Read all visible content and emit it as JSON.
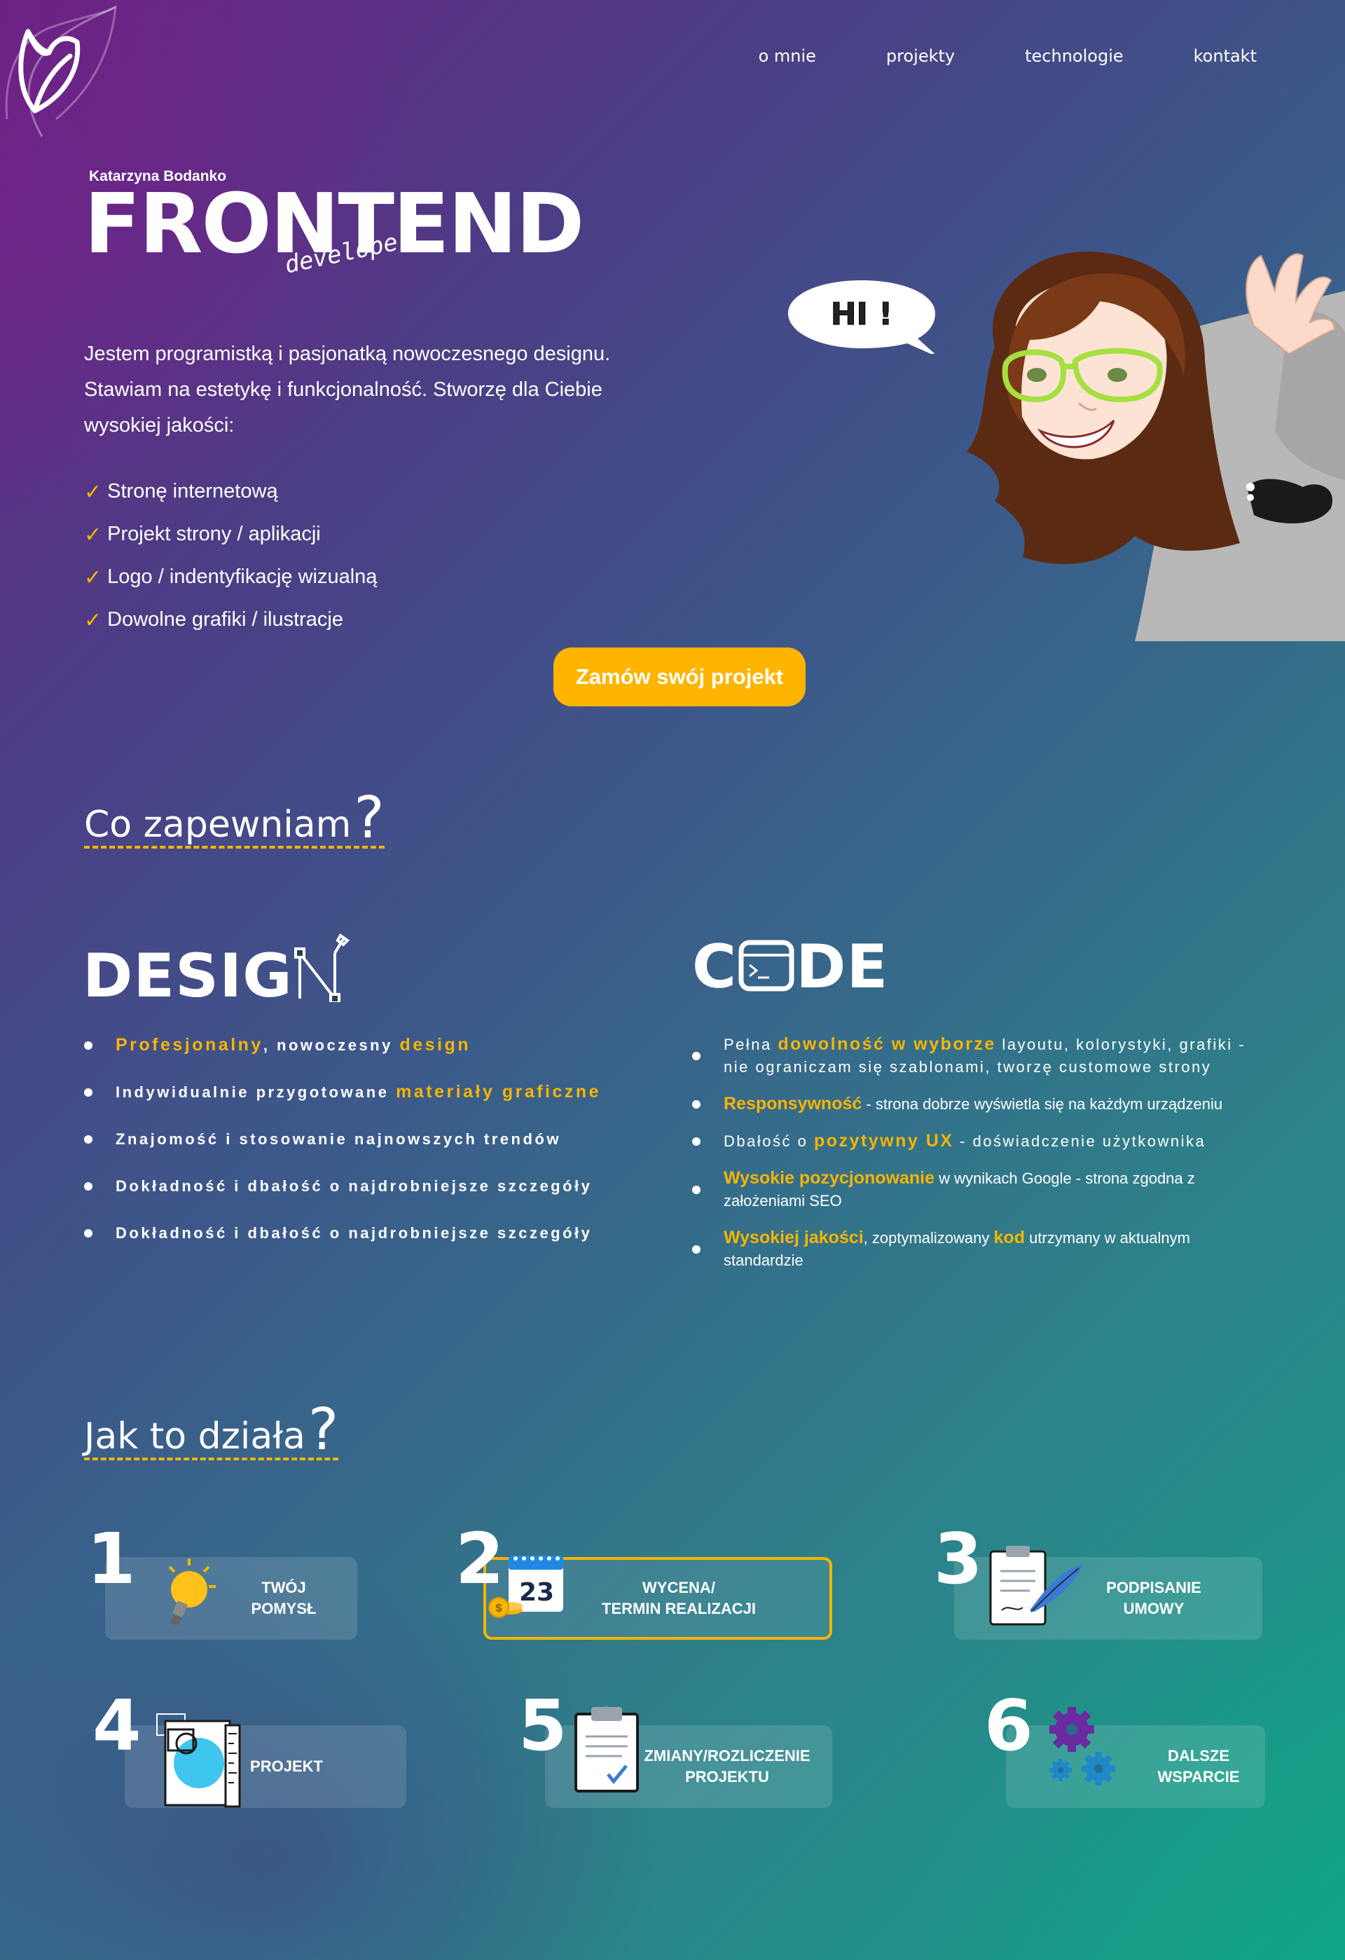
{
  "nav": {
    "items": [
      "o mnie",
      "projekty",
      "technologie",
      "kontakt"
    ]
  },
  "hero": {
    "name": "Katarzyna Bodanko",
    "title": "FRONTEND",
    "subtitle": "developer",
    "intro": "Jestem programistką i pasjonatką nowoczesnego designu. Stawiam na estetykę i funkcjonalność. Stworzę dla Ciebie wysokiej jakości:",
    "checklist": [
      "Stronę internetową",
      "Projekt strony / aplikacji",
      "Logo / indentyfikację wizualną",
      "Dowolne grafiki / ilustracje"
    ],
    "cta": "Zamów swój projekt",
    "bubble": "HI !"
  },
  "offer": {
    "heading": "Co zapewniam",
    "qmark": "?",
    "design_word": "DESIG",
    "design_icon": "pen-tool-n-icon",
    "code_word_left": "C",
    "code_word_right": "DE",
    "code_icon": "terminal-window-icon",
    "design_items": [
      {
        "parts": [
          {
            "t": "Profesjonalny",
            "hl": true
          },
          {
            "t": ", nowoczesny ",
            "hl": false
          },
          {
            "t": "design",
            "hl": true
          }
        ]
      },
      {
        "parts": [
          {
            "t": "Indywidualnie przygotowane ",
            "hl": false
          },
          {
            "t": "materiały graficzne",
            "hl": true
          }
        ]
      },
      {
        "parts": [
          {
            "t": "Znajomość i stosowanie najnowszych trendów",
            "hl": false
          }
        ]
      },
      {
        "parts": [
          {
            "t": "Dokładność i dbałość o najdrobniejsze szczegóły",
            "hl": false
          }
        ]
      },
      {
        "parts": [
          {
            "t": "Dokładność i dbałość o najdrobniejsze szczegóły",
            "hl": false
          }
        ]
      }
    ],
    "code_items": [
      {
        "spaced": true,
        "parts": [
          {
            "t": "Pełna ",
            "hl": false
          },
          {
            "t": "dowolność w wyborze",
            "hl": true
          },
          {
            "t": " layoutu, kolorystyki, grafiki - nie ograniczam się szablonami, tworzę customowe strony",
            "hl": false
          }
        ]
      },
      {
        "spaced": false,
        "parts": [
          {
            "t": "Responsywność",
            "hl": true
          },
          {
            "t": " - strona dobrze wyświetla się na każdym urządzeniu",
            "hl": false
          }
        ]
      },
      {
        "spaced": true,
        "parts": [
          {
            "t": "Dbałość o ",
            "hl": false
          },
          {
            "t": "pozytywny UX",
            "hl": true
          },
          {
            "t": " - doświadczenie użytkownika",
            "hl": false
          }
        ]
      },
      {
        "spaced": false,
        "parts": [
          {
            "t": "Wysokie pozycjonowanie",
            "hl": true
          },
          {
            "t": " w wynikach Google - strona zgodna z założeniami SEO",
            "hl": false
          }
        ]
      },
      {
        "spaced": false,
        "parts": [
          {
            "t": "Wysokiej jakości",
            "hl": true
          },
          {
            "t": ", zoptymalizowany ",
            "hl": false
          },
          {
            "t": "kod",
            "hl": true
          },
          {
            "t": " utrzymany w aktualnym standardzie",
            "hl": false
          }
        ]
      }
    ]
  },
  "process": {
    "heading": "Jak to działa",
    "qmark": "?",
    "steps": [
      {
        "num": "1",
        "label": "TWÓJ\nPOMYSŁ",
        "icon": "lightbulb-icon"
      },
      {
        "num": "2",
        "label": "WYCENA/\nTERMIN REALIZACJI",
        "icon": "calendar-coins-icon",
        "calendar_day": "23",
        "active": true
      },
      {
        "num": "3",
        "label": "PODPISANIE\nUMOWY",
        "icon": "contract-quill-icon"
      },
      {
        "num": "4",
        "label": "PROJEKT",
        "icon": "design-sheets-icon"
      },
      {
        "num": "5",
        "label": "ZMIANY/ROZLICZENIE\nPROJEKTU",
        "icon": "clipboard-check-icon"
      },
      {
        "num": "6",
        "label": "DALSZE\nWSPARCIE",
        "icon": "gears-icon"
      }
    ]
  },
  "colors": {
    "accent": "#f7b500",
    "bg_start": "#6b2283",
    "bg_end": "#16a087"
  }
}
